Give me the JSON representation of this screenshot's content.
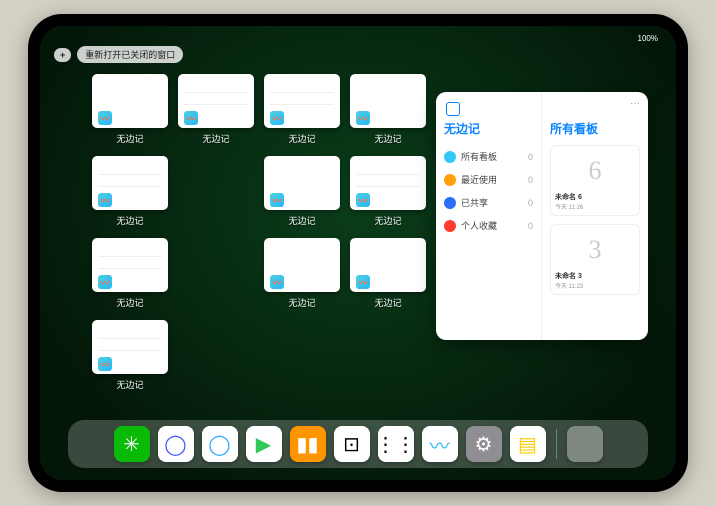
{
  "status": {
    "left_time": "",
    "right_indicators": "100%"
  },
  "topbar": {
    "add_label": "+",
    "reopen_label": "重新打开已关闭的窗口"
  },
  "grid": {
    "items": [
      {
        "label": "无边记",
        "variant": "blank"
      },
      {
        "label": "无边记",
        "variant": "cal"
      },
      {
        "label": "无边记",
        "variant": "cal"
      },
      {
        "label": "无边记",
        "variant": "blank"
      },
      {
        "label": "无边记",
        "variant": "cal"
      },
      {
        "label": "无边记",
        "variant": "blank",
        "hidden": true
      },
      {
        "label": "无边记",
        "variant": "blank"
      },
      {
        "label": "无边记",
        "variant": "cal"
      },
      {
        "label": "无边记",
        "variant": "cal"
      },
      {
        "label": "无边记",
        "variant": "blank",
        "hidden": true
      },
      {
        "label": "无边记",
        "variant": "blank"
      },
      {
        "label": "无边记",
        "variant": "blank"
      },
      {
        "label": "无边记",
        "variant": "cal"
      }
    ]
  },
  "bigwin": {
    "left": {
      "title": "无边记",
      "rows": [
        {
          "icon_color": "#34c8f5",
          "label": "所有看板",
          "count": "0"
        },
        {
          "icon_color": "#ff9f0a",
          "label": "最近使用",
          "count": "0"
        },
        {
          "icon_color": "#2d6ef6",
          "label": "已共享",
          "count": "0"
        },
        {
          "icon_color": "#ff3b30",
          "label": "个人收藏",
          "count": "0"
        }
      ]
    },
    "right": {
      "title": "所有看板",
      "cards": [
        {
          "sketch": "6",
          "label": "未命名 6",
          "sub": "今天 11:26"
        },
        {
          "sketch": "3",
          "label": "未命名 3",
          "sub": "今天 11:23"
        }
      ]
    },
    "menu": "···"
  },
  "dock": {
    "apps": [
      {
        "name": "wechat",
        "bg": "#09bb07",
        "glyph": "✳"
      },
      {
        "name": "browser-circle",
        "bg": "#ffffff",
        "glyph": "◯",
        "fg": "#4455ff"
      },
      {
        "name": "browser-q",
        "bg": "#ffffff",
        "glyph": "◯",
        "fg": "#2aa9ff"
      },
      {
        "name": "play",
        "bg": "#ffffff",
        "glyph": "▶",
        "fg": "#34c759"
      },
      {
        "name": "books",
        "bg": "#ff9500",
        "glyph": "▮▮",
        "fg": "#fff"
      },
      {
        "name": "dice",
        "bg": "#ffffff",
        "glyph": "⊡",
        "fg": "#000"
      },
      {
        "name": "nodes",
        "bg": "#ffffff",
        "glyph": "⋮⋮",
        "fg": "#000"
      },
      {
        "name": "freeform",
        "bg": "#ffffff",
        "glyph": "〰",
        "fg": "#29b6f6"
      },
      {
        "name": "settings",
        "bg": "#8e8e93",
        "glyph": "⚙"
      },
      {
        "name": "notes",
        "bg": "#ffffff",
        "glyph": "▤",
        "fg": "#ffcc00"
      }
    ],
    "folder": {
      "name": "app-folder",
      "tiles": [
        "#4fc3f7",
        "#34c759",
        "#ff9f0a",
        "#5e5ce6"
      ]
    }
  }
}
